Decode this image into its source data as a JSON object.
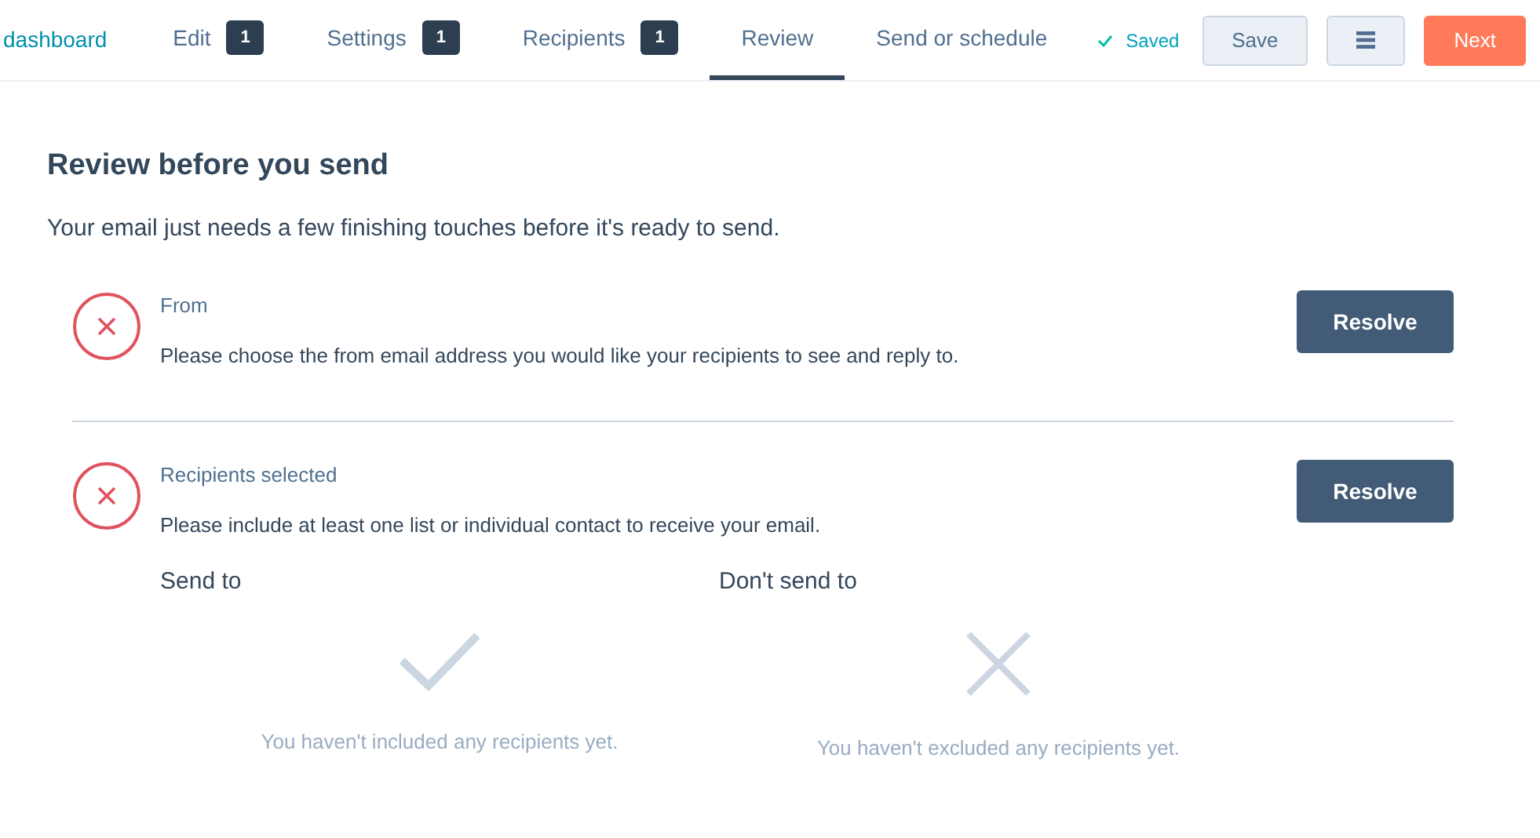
{
  "nav": {
    "back_link": "dashboard",
    "tabs": [
      {
        "label": "Edit",
        "badge": "1",
        "selected": false
      },
      {
        "label": "Settings",
        "badge": "1",
        "selected": false
      },
      {
        "label": "Recipients",
        "badge": "1",
        "selected": false
      },
      {
        "label": "Review",
        "selected": true
      },
      {
        "label": "Send or schedule",
        "selected": false
      }
    ],
    "saved_status": "Saved",
    "buttons": [
      {
        "kind": "secondary",
        "label": "Save"
      },
      {
        "kind": "menu"
      },
      {
        "kind": "primary",
        "label": "Next"
      }
    ]
  },
  "review": {
    "title": "Review before you send",
    "subtitle": "Your email just needs a few finishing touches before it's ready to send.",
    "issues": [
      {
        "title": "From",
        "message": "Please choose the from email address you would like your recipients to see and reply to.",
        "action": "Resolve"
      },
      {
        "title": "Recipients selected",
        "message": "Please include at least one list or individual contact to receive your email.",
        "action": "Resolve",
        "columns": [
          {
            "kind": "include",
            "heading": "Send to",
            "empty_text": "You haven't included any recipients yet."
          },
          {
            "kind": "exclude",
            "heading": "Don't send to",
            "empty_text": "You haven't excluded any recipients yet."
          }
        ]
      }
    ]
  }
}
